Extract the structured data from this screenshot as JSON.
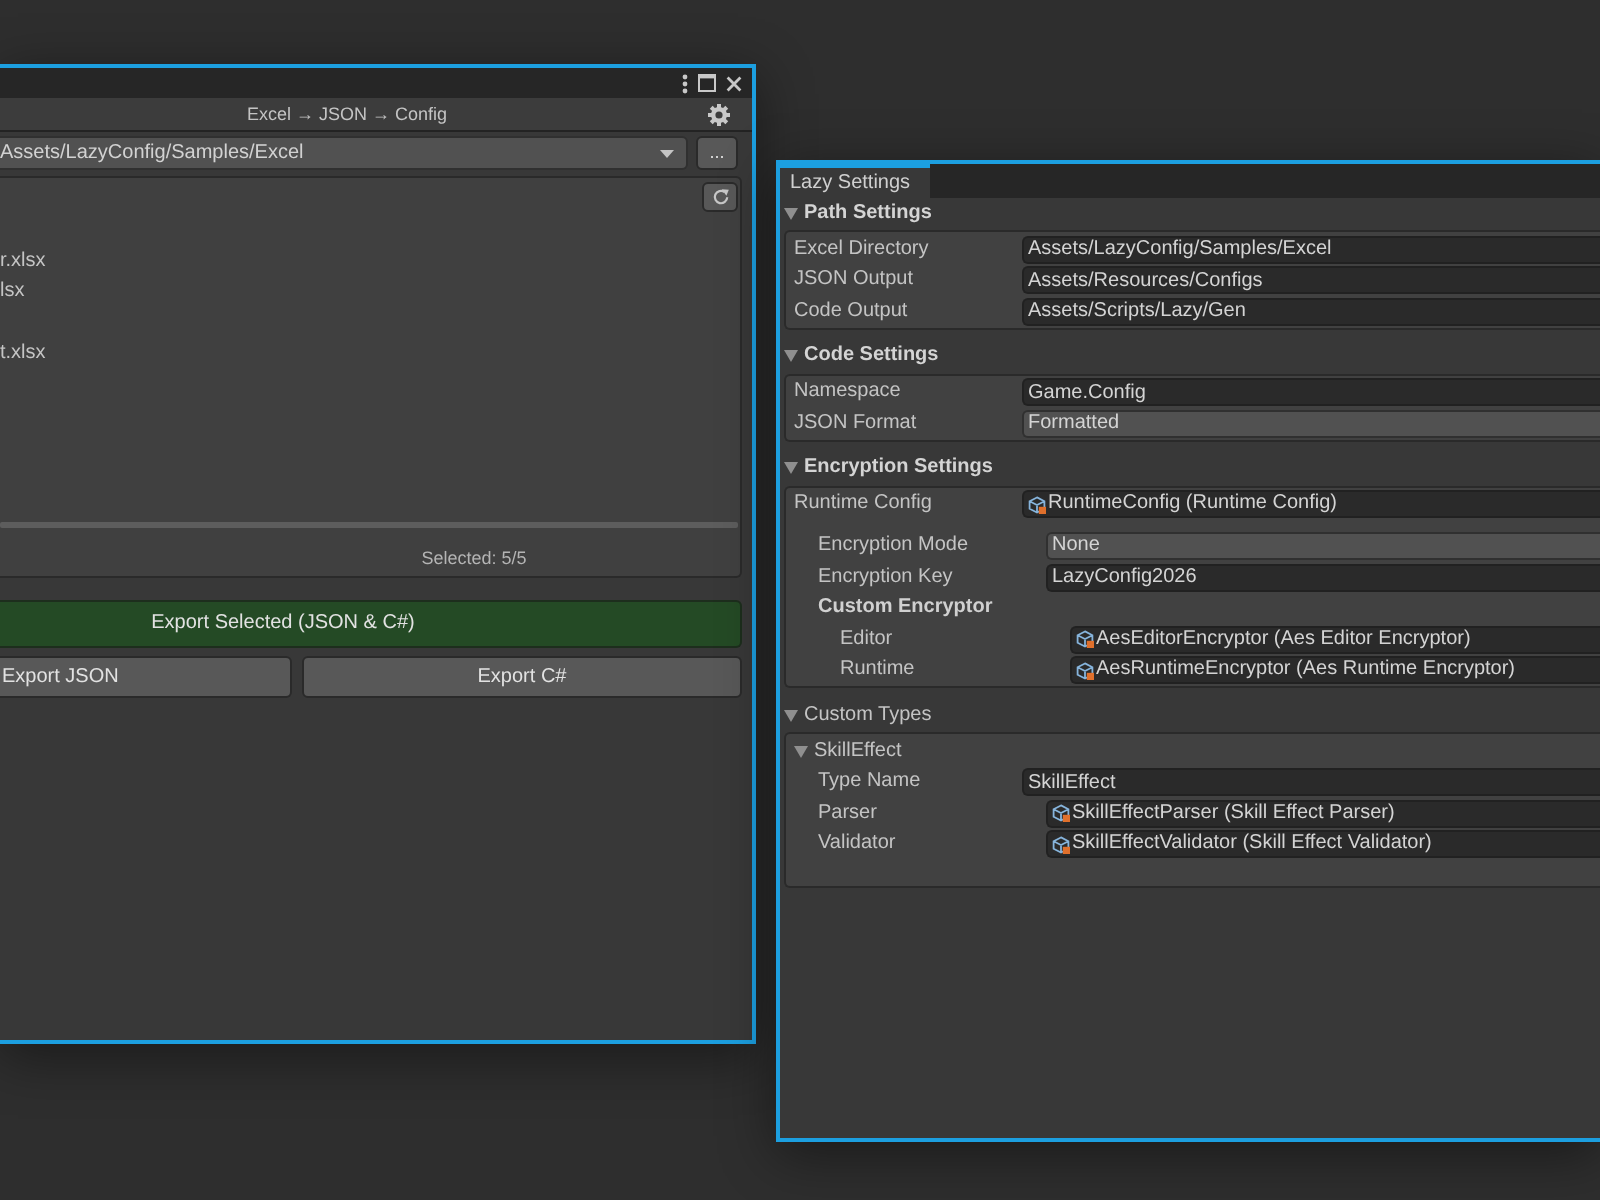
{
  "editor_window": {
    "toolbar_title": "Excel → JSON → Config",
    "directory": {
      "value": "Assets/LazyConfig/Samples/Excel",
      "browse_label": "..."
    },
    "files": [
      {
        "name": "r.xlsx"
      },
      {
        "name": "lsx"
      },
      {
        "name": "t.xlsx"
      }
    ],
    "selection_status": "Selected: 5/5",
    "buttons": [
      {
        "label": "Export Selected (JSON & C#)",
        "kind": "primary"
      },
      {
        "label": "Export JSON",
        "kind": "secondary"
      },
      {
        "label": "Export C#",
        "kind": "secondary"
      }
    ]
  },
  "settings_window": {
    "tab": {
      "label": "Lazy Settings",
      "selected": true
    },
    "sections": [
      {
        "title": "Path Settings",
        "kind": "header",
        "expanded": true,
        "rows": [
          {
            "kind": "text",
            "label": "Excel Directory",
            "value": "Assets/LazyConfig/Samples/Excel"
          },
          {
            "kind": "text",
            "label": "JSON Output",
            "value": "Assets/Resources/Configs"
          },
          {
            "kind": "text",
            "label": "Code Output",
            "value": "Assets/Scripts/Lazy/Gen"
          }
        ]
      },
      {
        "title": "Code Settings",
        "kind": "header",
        "expanded": true,
        "rows": [
          {
            "kind": "text",
            "label": "Namespace",
            "value": "Game.Config"
          },
          {
            "kind": "dropdown",
            "label": "JSON Format",
            "value": "Formatted"
          }
        ]
      },
      {
        "title": "Encryption Settings",
        "kind": "header",
        "expanded": true,
        "rows": [
          {
            "kind": "object",
            "label": "Runtime Config",
            "value": "RuntimeConfig (Runtime Config)",
            "children": [
              {
                "kind": "dropdown",
                "label": "Encryption Mode",
                "value": "None"
              },
              {
                "kind": "text",
                "label": "Encryption Key",
                "value": "LazyConfig2026"
              },
              {
                "kind": "group",
                "label": "Custom Encryptor",
                "children": [
                  {
                    "kind": "object",
                    "label": "Editor",
                    "value": "AesEditorEncryptor (Aes Editor Encryptor)"
                  },
                  {
                    "kind": "object",
                    "label": "Runtime",
                    "value": "AesRuntimeEncryptor (Aes Runtime Encryptor)"
                  }
                ]
              }
            ]
          }
        ]
      },
      {
        "title": "Custom Types",
        "kind": "foldout",
        "expanded": true,
        "rows": [
          {
            "kind": "element",
            "label": "SkillEffect",
            "expanded": true,
            "children": [
              {
                "kind": "text",
                "label": "Type Name",
                "value": "SkillEffect"
              },
              {
                "kind": "object",
                "label": "Parser",
                "value": "SkillEffectParser (Skill Effect Parser)"
              },
              {
                "kind": "object",
                "label": "Validator",
                "value": "SkillEffectValidator (Skill Effect Validator)"
              }
            ]
          }
        ]
      }
    ]
  }
}
